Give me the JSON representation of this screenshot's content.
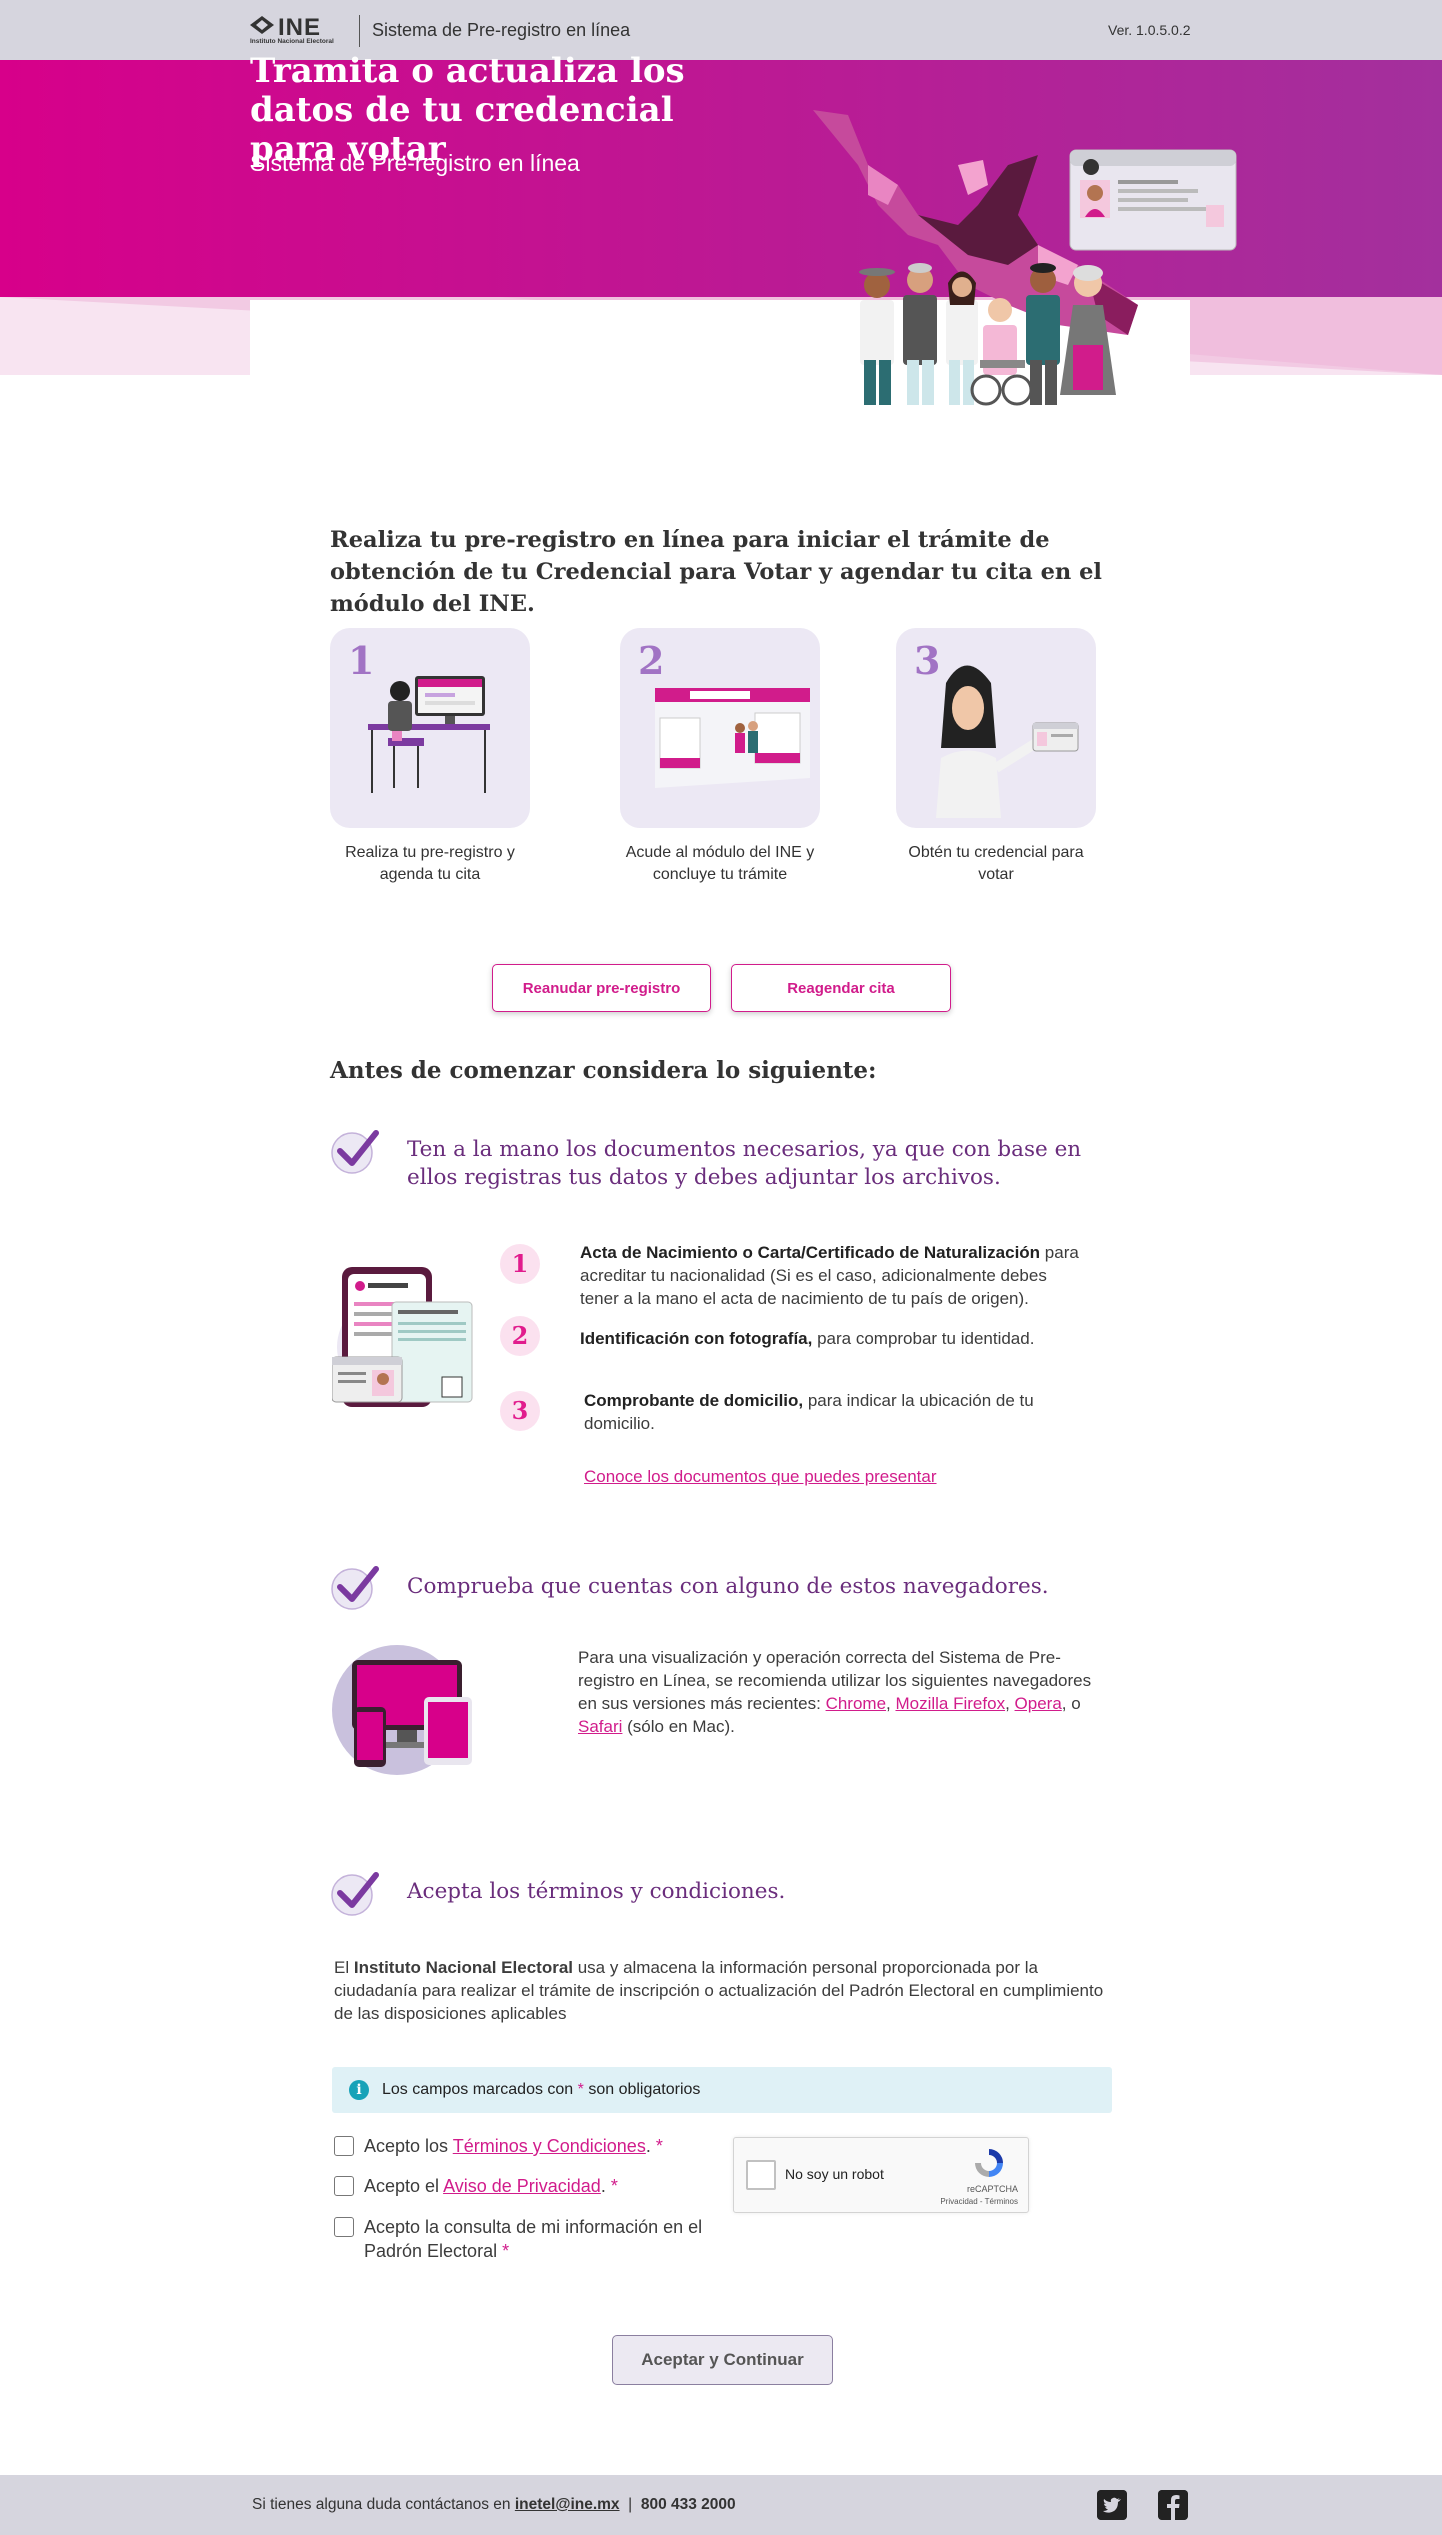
{
  "header": {
    "logo_text": "INE",
    "logo_sub": "Instituto Nacional Electoral",
    "title": "Sistema de Pre-registro en línea",
    "version": "Ver. 1.0.5.0.2"
  },
  "hero": {
    "title": "Tramita o actualiza los datos de tu credencial para votar",
    "subtitle": "Sistema de Pre-registro en línea"
  },
  "intro": "Realiza tu pre-registro en línea para iniciar el trámite de obtención de tu Credencial para Votar y agendar tu cita en el módulo del INE.",
  "steps": [
    {
      "num": "1",
      "label": "Realiza tu pre-registro y agenda tu cita"
    },
    {
      "num": "2",
      "label": "Acude al módulo del INE y concluye tu trámite"
    },
    {
      "num": "3",
      "label": "Obtén tu credencial para votar"
    }
  ],
  "buttons": {
    "resume": "Reanudar pre-registro",
    "reschedule": "Reagendar cita",
    "submit": "Aceptar y Continuar"
  },
  "before_title": "Antes de comenzar considera lo siguiente:",
  "documents": {
    "title": "Ten a la mano los documentos necesarios, ya que con base en ellos registras tus datos y debes adjuntar los archivos.",
    "items": [
      {
        "num": "1",
        "bold": "Acta de Nacimiento o Carta/Certificado de Naturalización",
        "text": " para acreditar tu nacionalidad (Si es el caso, adicionalmente debes tener a la mano el acta de nacimiento de tu país de origen)."
      },
      {
        "num": "2",
        "bold": "Identificación con fotografía,",
        "text": " para comprobar tu identidad."
      },
      {
        "num": "3",
        "bold": "Comprobante de domicilio,",
        "text": " para indicar la ubicación de tu domicilio."
      }
    ],
    "link": "Conoce los documentos que puedes presentar"
  },
  "browsers": {
    "title": "Comprueba que cuentas con alguno de estos navegadores.",
    "text_before": "Para una visualización y operación correcta del Sistema de Pre-registro en Línea, se recomienda utilizar los siguientes navegadores en sus versiones más recientes: ",
    "chrome": "Chrome",
    "firefox": "Mozilla Firefox",
    "opera": "Opera",
    "safari": "Safari",
    "sep1": ", ",
    "sep2": ", ",
    "sep3": ", o ",
    "text_after": " (sólo en Mac)."
  },
  "terms": {
    "title": "Acepta los términos y condiciones.",
    "para_prefix": "El ",
    "para_bold": "Instituto Nacional Electoral",
    "para_rest": " usa y almacena la información personal proporcionada por la ciudadanía para realizar el trámite de inscripción o actualización del Padrón Electoral en cumplimiento de las disposiciones aplicables",
    "alert_before": "Los campos marcados con ",
    "alert_star": "*",
    "alert_after": " son obligatorios",
    "cb1_before": "Acepto los ",
    "cb1_link": "Términos y Condiciones",
    "cb1_after": ". ",
    "cb2_before": "Acepto el ",
    "cb2_link": "Aviso de Privacidad",
    "cb2_after": ". ",
    "cb3_text": "Acepto la consulta de mi información en el Padrón Electoral ",
    "star": "*"
  },
  "recaptcha": {
    "label": "No soy un robot",
    "brand": "reCAPTCHA",
    "terms": "Privacidad - Términos"
  },
  "footer": {
    "text": "Si tienes alguna duda contáctanos en ",
    "email": "inetel@ine.mx",
    "sep": "|",
    "phone": "800 433 2000"
  },
  "colors": {
    "brand_pink": "#d11c8b",
    "brand_purple": "#6a2d7c",
    "bar_gray": "#d6d5de"
  }
}
